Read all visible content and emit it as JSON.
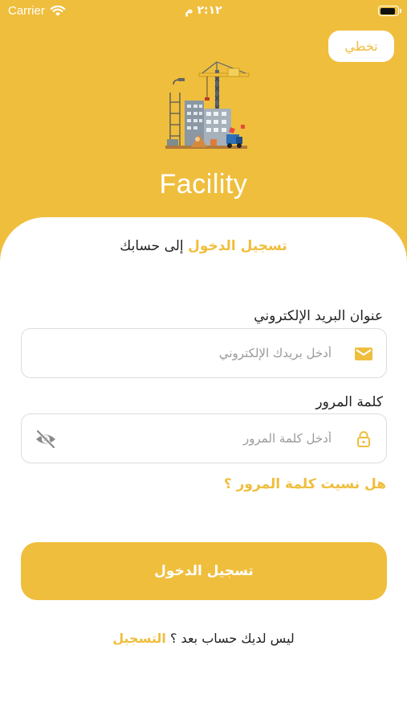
{
  "status_bar": {
    "carrier": "Carrier",
    "time": "٢:١٢ م",
    "wifi_icon": "wifi-icon",
    "battery_icon": "battery-icon"
  },
  "header": {
    "skip_label": "تخطي",
    "app_name": "Facility",
    "logo_icon": "construction-logo"
  },
  "login": {
    "headline_accent": "تسجيل الدخول",
    "headline_rest": " إلى حسابك",
    "email": {
      "label": "عنوان البريد الإلكتروني",
      "placeholder": "أدخل بريدك الإلكتروني",
      "value": "",
      "icon": "mail-icon"
    },
    "password": {
      "label": "كلمة المرور",
      "placeholder": "أدخل كلمة المرور",
      "value": "",
      "icon": "lock-icon",
      "toggle_icon": "eye-off-icon"
    },
    "forgot_label": "هل نسيت كلمة المرور ؟",
    "submit_label": "تسجيل الدخول",
    "no_account_text": "ليس لديك حساب بعد ؟ ",
    "signup_label": "التسجيل"
  },
  "colors": {
    "accent": "#efbe3d",
    "text": "#222222",
    "placeholder": "#9a9a9a"
  }
}
